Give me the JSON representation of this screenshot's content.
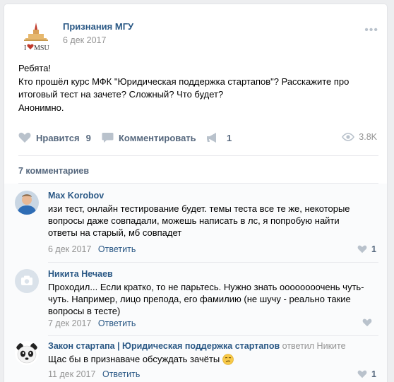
{
  "post": {
    "group_name": "Признания МГУ",
    "logo_text": "I ♥ MSU",
    "date": "6 дек 2017",
    "more": "•••",
    "text_lines": [
      "Ребята!",
      "Кто прошёл курс МФК \"Юридическая поддержка стартапов\"? Расскажите про",
      "итоговый тест на зачете? Сложный? Что будет?",
      "Анонимно."
    ],
    "actions": {
      "like_label": "Нравится",
      "like_count": "9",
      "comment_label": "Комментировать",
      "share_count": "1",
      "views": "3.8K"
    },
    "comments_count_label": "7 комментариев"
  },
  "comments": [
    {
      "author": "Max Korobov",
      "lines": [
        "изи тест, онлайн тестирование будет. темы теста все те же, некоторые",
        "вопросы даже совпадали, можешь написать в лс, я попробую найти",
        "ответы на старый, мб совпадет"
      ],
      "date": "6 дек 2017",
      "reply_label": "Ответить",
      "likes": "1"
    },
    {
      "author": "Никита Нечаев",
      "lines": [
        "Проходил... Если кратко, то не парьтесь. Нужно знать оооооооочень чуть-",
        "чуть. Например, лицо препода, его фамилию (не шучу - реально такие",
        "вопросы в тесте)"
      ],
      "date": "7 дек 2017",
      "reply_label": "Ответить",
      "likes": ""
    },
    {
      "author": "Закон стартапа | Юридическая поддержка стартапов",
      "reply_note": "ответил Никите",
      "lines": [
        "Щас бы в признаваче обсуждать зачёты"
      ],
      "date": "11 дек 2017",
      "reply_label": "Ответить",
      "likes": "1"
    }
  ],
  "colors": {
    "link": "#2a5885",
    "muted": "#939393",
    "icon": "#b9c2cc"
  }
}
